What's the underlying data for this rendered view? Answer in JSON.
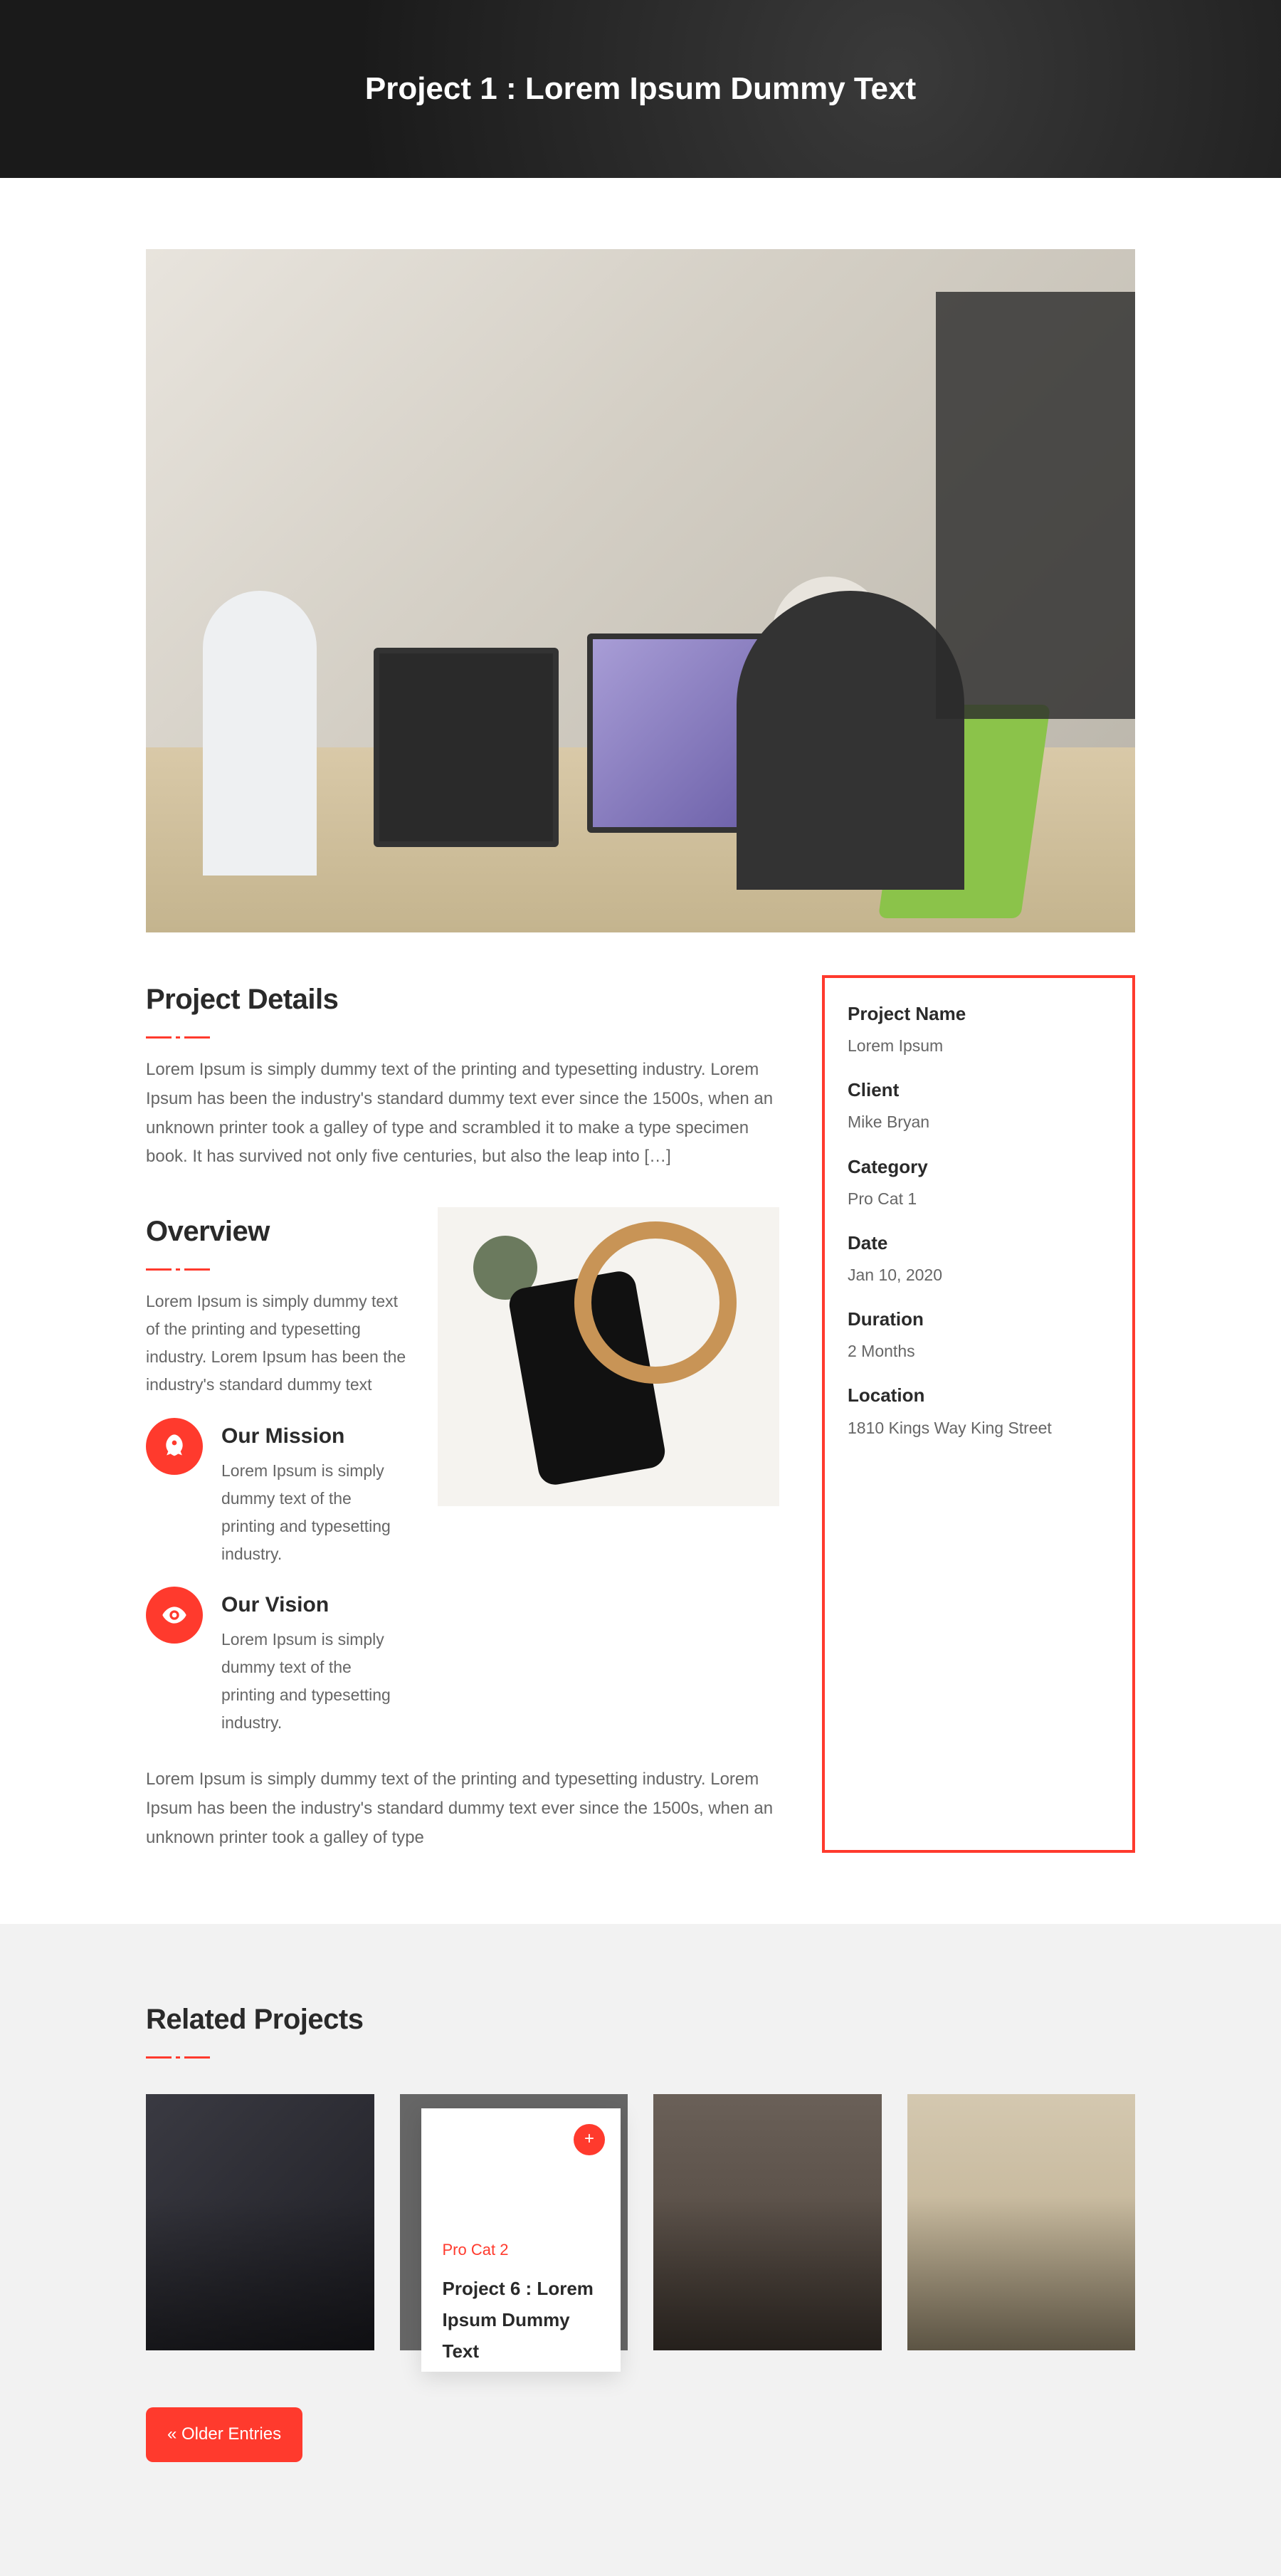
{
  "hero": {
    "title": "Project 1 : Lorem Ipsum Dummy Text"
  },
  "details": {
    "heading": "Project Details",
    "body": "Lorem Ipsum is simply dummy text of the printing and typesetting industry. Lorem Ipsum has been the industry's standard dummy text ever since the 1500s, when an unknown printer took a galley of type and scrambled it to make a type specimen book. It has survived not only five centuries, but also the leap into […]"
  },
  "overview": {
    "heading": "Overview",
    "intro": "Lorem Ipsum is simply dummy text of the printing and typesetting industry. Lorem Ipsum has been the industry's standard dummy text",
    "mission": {
      "title": "Our Mission",
      "body": "Lorem Ipsum is simply dummy text of the printing and typesetting industry."
    },
    "vision": {
      "title": "Our Vision",
      "body": "Lorem Ipsum is simply dummy text of the printing and typesetting industry."
    },
    "footer": "Lorem Ipsum is simply dummy text of the printing and typesetting industry. Lorem Ipsum has been the industry's standard dummy text ever since the 1500s, when an unknown printer took a galley of type"
  },
  "sidebar": {
    "project_name_label": "Project Name",
    "project_name": "Lorem Ipsum",
    "client_label": "Client",
    "client": "Mike Bryan",
    "category_label": "Category",
    "category": "Pro Cat 1",
    "date_label": "Date",
    "date": "Jan 10, 2020",
    "duration_label": "Duration",
    "duration": "2 Months",
    "location_label": "Location",
    "location": "1810 Kings Way King Street"
  },
  "related": {
    "heading": "Related Projects",
    "card2": {
      "category": "Pro Cat 2",
      "title": "Project 6 : Lorem Ipsum Dummy Text"
    },
    "older": "« Older Entries"
  }
}
